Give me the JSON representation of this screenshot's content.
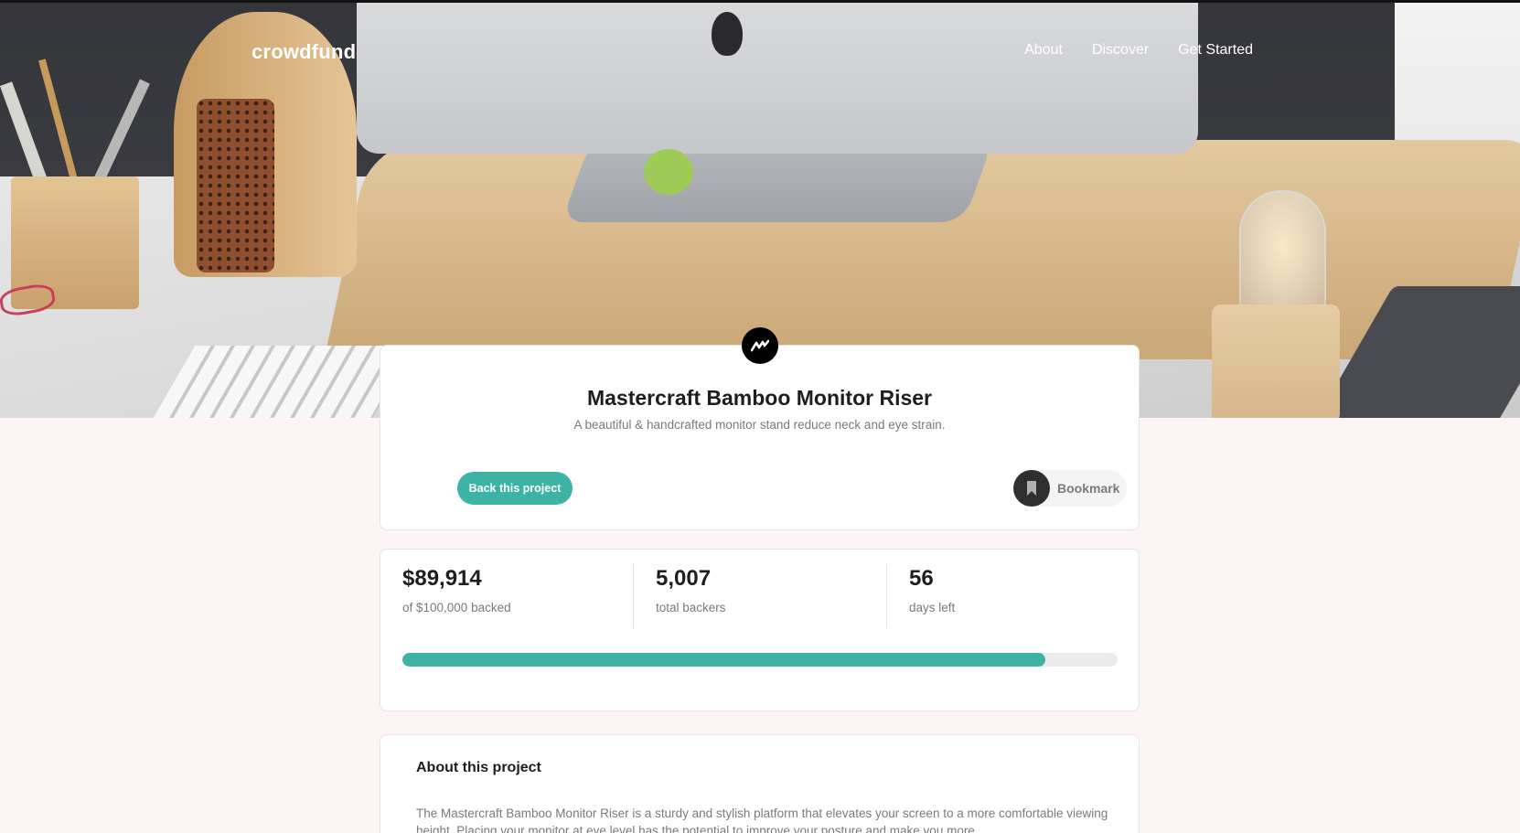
{
  "header": {
    "logo": "crowdfund",
    "nav": [
      {
        "label": "About"
      },
      {
        "label": "Discover"
      },
      {
        "label": "Get Started"
      }
    ]
  },
  "project": {
    "title": "Mastercraft Bamboo Monitor Riser",
    "subtitle": "A beautiful & handcrafted monitor stand reduce neck and eye strain.",
    "back_label": "Back this project",
    "bookmark_label": "Bookmark"
  },
  "stats": {
    "backed_amount": "$89,914",
    "backed_label": "of $100,000 backed",
    "backers": "5,007",
    "backers_label": "total backers",
    "days": "56",
    "days_label": "days left",
    "progress_fraction": 0.89914
  },
  "about": {
    "title": "About this project",
    "body": "The Mastercraft Bamboo Monitor Riser is a sturdy and stylish platform that elevates your screen to a more comfortable viewing height. Placing your monitor at eye level has the potential to improve your posture and make you more"
  },
  "icons": {
    "brand": "mastercraft-logo-icon",
    "bookmark": "bookmark-icon"
  },
  "colors": {
    "accent": "#3cb3a5",
    "background": "#fdf5f5",
    "dark": "#2f2f2f"
  }
}
